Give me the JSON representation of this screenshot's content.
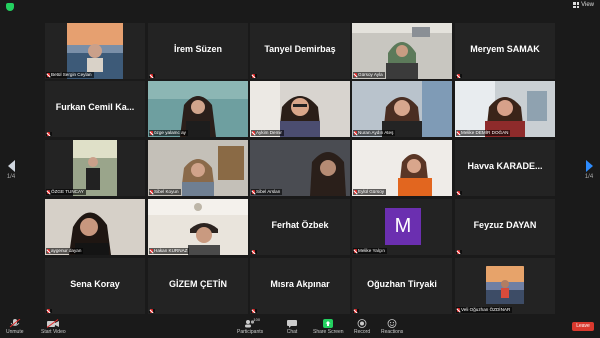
{
  "topbar": {
    "view_label": "View"
  },
  "pagination": {
    "left": "1/4",
    "right": "1/4"
  },
  "tiles": {
    "r1c1": "Betül Sergin Ceylan",
    "r1c2": "İrem Süzen",
    "r1c3": "Tanyel Demirbaş",
    "r1c4": "Gürsoy Ayla",
    "r1c5": "Meryem SAMAK",
    "r2c1": "Furkan Cemil Ka...",
    "r2c2": "özge yalamc ay",
    "r2c3": "Aykim Demir",
    "r2c4": "Nuran Aydın Ateş",
    "r2c5": "Melike DEMİR DOĞAN",
    "r3c1": "ÖZGE TUNCAY",
    "r3c2": "Sibel Koyun",
    "r3c3": "Sibel Arslan",
    "r3c4": "Eylül Gürsoy",
    "r3c5": "Havva KARADE...",
    "r4c1": "aygenur dayan",
    "r4c2": "Hakan KURNAZ",
    "r4c3": "Ferhat Özbek",
    "r4c4": "Melike Yalçın",
    "r4c5": "Feyzuz DAYAN",
    "r5c1": "Sena Koray",
    "r5c2": "GİZEM ÇETİN",
    "r5c3": "Mısra Akpınar",
    "r5c4": "Oğuzhan Tiryaki",
    "r5c5": "Veli Oğuzhan ÖZDİNAR"
  },
  "avatar_letter": "M",
  "toolbar": {
    "unmute": "Unmute",
    "start_video": "Start Video",
    "participants": "Participants",
    "participants_count": "100",
    "chat": "Chat",
    "share_screen": "Share Screen",
    "record": "Record",
    "reactions": "Reactions",
    "leave": "Leave"
  },
  "colors": {
    "share_green": "#23d160",
    "leave_red": "#d9392e",
    "avatar_purple": "#6b2fb0",
    "speaking": "#7cd93e"
  }
}
